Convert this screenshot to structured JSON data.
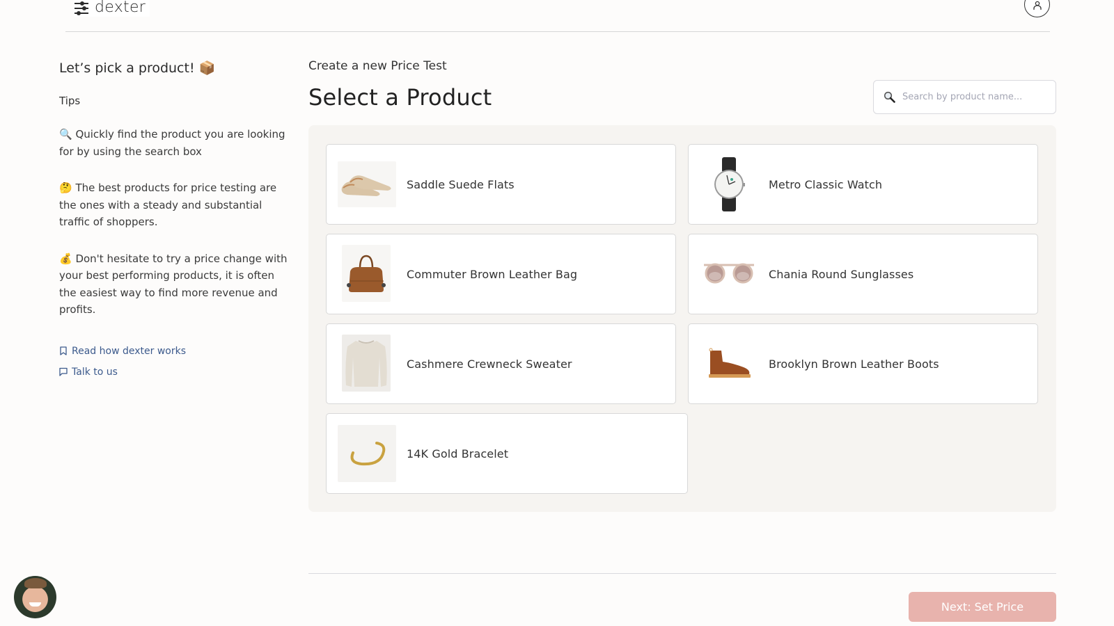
{
  "header": {
    "logo_text": "dexter",
    "logo_icon": "sliders-icon",
    "user_icon": "user-icon"
  },
  "sidebar": {
    "heading": "Let’s pick a product! 📦",
    "tips_label": "Tips",
    "tips": [
      "🔍 Quickly find the product you are looking for by using the search box",
      "🤔 The best products for price testing are the ones with a steady and substantial traffic of shoppers.",
      "💰 Don't hesitate to try a price change with your best performing products, it is often the easiest way to find more revenue and profits."
    ],
    "links": [
      {
        "label": "Read how dexter works",
        "icon": "bookmark-icon"
      },
      {
        "label": "Talk to us",
        "icon": "chat-bubble-icon"
      }
    ]
  },
  "main": {
    "subtitle": "Create a new Price Test",
    "title": "Select a Product",
    "search": {
      "placeholder": "Search by product name...",
      "value": "",
      "icon": "search-icon"
    },
    "products": [
      {
        "name": "Saddle Suede Flats",
        "image": "flats"
      },
      {
        "name": "Metro Classic Watch",
        "image": "watch"
      },
      {
        "name": "Commuter Brown Leather Bag",
        "image": "bag"
      },
      {
        "name": "Chania Round Sunglasses",
        "image": "sunglasses"
      },
      {
        "name": "Cashmere Crewneck Sweater",
        "image": "sweater"
      },
      {
        "name": "Brooklyn Brown Leather Boots",
        "image": "boots"
      },
      {
        "name": "14K Gold Bracelet",
        "image": "bracelet"
      }
    ]
  },
  "footer": {
    "next_label": "Next: Set Price",
    "next_color": "#e8b3ad"
  },
  "colors": {
    "link": "#3c5a8c",
    "panel_bg": "#f6f4f1",
    "page_bg": "#fdfcfb"
  }
}
